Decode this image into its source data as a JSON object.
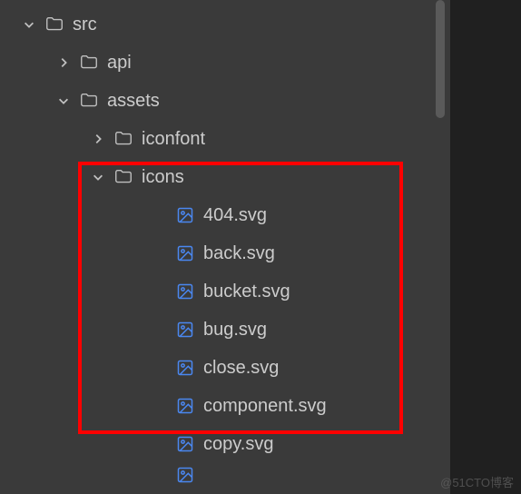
{
  "tree": {
    "src": {
      "label": "src",
      "expanded": true
    },
    "api": {
      "label": "api",
      "expanded": false
    },
    "assets": {
      "label": "assets",
      "expanded": true
    },
    "iconfont": {
      "label": "iconfont",
      "expanded": false
    },
    "icons": {
      "label": "icons",
      "expanded": true
    },
    "files": {
      "f0": "404.svg",
      "f1": "back.svg",
      "f2": "bucket.svg",
      "f3": "bug.svg",
      "f4": "close.svg",
      "f5": "component.svg",
      "f6": "copy.svg"
    }
  },
  "watermark": "@51CTO博客"
}
